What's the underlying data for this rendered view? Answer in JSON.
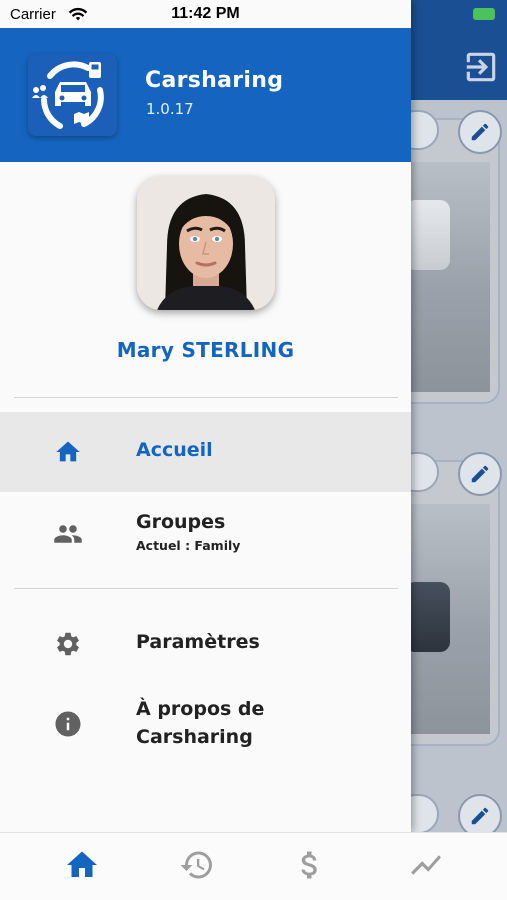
{
  "status_bar": {
    "carrier": "Carrier",
    "time": "11:42 PM"
  },
  "app": {
    "title": "Carsharing",
    "version": "1.0.17",
    "logo_icon": "car-sharing-logo-icon"
  },
  "user": {
    "name": "Mary STERLING",
    "avatar_icon": "user-avatar"
  },
  "menu": [
    {
      "label": "Accueil",
      "icon": "home-icon",
      "active": true
    },
    {
      "label": "Groupes",
      "sub": "Actuel : Family",
      "icon": "group-icon",
      "active": false
    },
    {
      "label": "Paramètres",
      "icon": "gear-icon",
      "active": false
    },
    {
      "label": "À propos de\nCarsharing",
      "label_line1": "À propos de",
      "label_line2": "Carsharing",
      "icon": "info-icon",
      "active": false
    }
  ],
  "tabbar": [
    {
      "icon": "home-icon",
      "active": true
    },
    {
      "icon": "history-icon",
      "active": false
    },
    {
      "icon": "dollar-icon",
      "active": false
    },
    {
      "icon": "trending-icon",
      "active": false
    }
  ],
  "colors": {
    "primary": "#1565c0",
    "active_row": "#e8e8e8",
    "icon_grey": "#616161",
    "tab_inactive": "#9e9e9e"
  }
}
